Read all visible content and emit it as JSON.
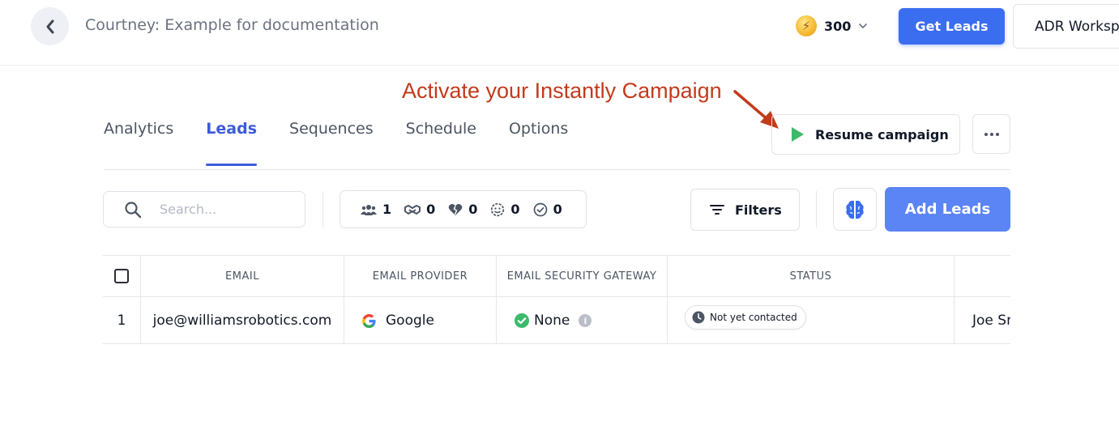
{
  "header": {
    "title": "Courtney: Example for documentation",
    "credits": "300",
    "get_leads_label": "Get Leads",
    "workspace_label": "ADR Workspace"
  },
  "annotation": {
    "text": "Activate your Instantly Campaign",
    "color": "#c23b1c"
  },
  "tabs": [
    {
      "label": "Analytics",
      "active": false
    },
    {
      "label": "Leads",
      "active": true
    },
    {
      "label": "Sequences",
      "active": false
    },
    {
      "label": "Schedule",
      "active": false
    },
    {
      "label": "Options",
      "active": false
    }
  ],
  "actions": {
    "resume_label": "Resume campaign"
  },
  "toolbar": {
    "search_placeholder": "Search...",
    "stats": [
      {
        "icon": "people-icon",
        "value": "1"
      },
      {
        "icon": "handshake-icon",
        "value": "0"
      },
      {
        "icon": "broken-heart-icon",
        "value": "0"
      },
      {
        "icon": "smile-icon",
        "value": "0"
      },
      {
        "icon": "check-circle-icon",
        "value": "0"
      }
    ],
    "filters_label": "Filters",
    "add_leads_label": "Add Leads"
  },
  "table": {
    "columns": [
      "EMAIL",
      "EMAIL PROVIDER",
      "EMAIL SECURITY GATEWAY",
      "STATUS"
    ],
    "rows": [
      {
        "index": "1",
        "email": "joe@williamsrobotics.com",
        "provider": "Google",
        "gateway": "None",
        "status": "Not yet contacted",
        "name": "Joe Smith"
      }
    ]
  },
  "colors": {
    "primary": "#3b6df0",
    "active_tab": "#3b5bdb",
    "add_leads": "#5b84f5",
    "success": "#3cba6a"
  }
}
